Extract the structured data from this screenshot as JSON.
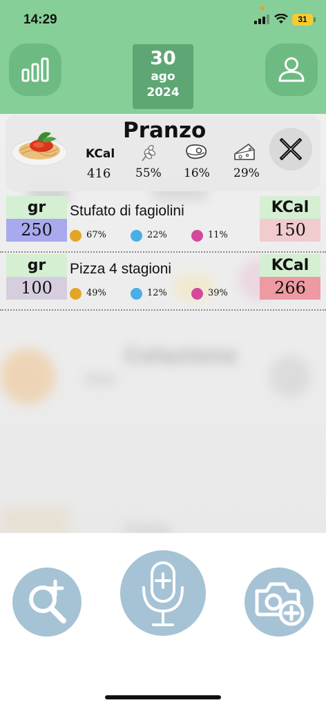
{
  "status_bar": {
    "time": "14:29",
    "battery": "31"
  },
  "header": {
    "date": {
      "day": "30",
      "month": "ago",
      "year": "2024"
    },
    "stats_icon": "bar-chart-icon",
    "profile_icon": "person-icon",
    "color": "#86cf98"
  },
  "meal": {
    "title": "Pranzo",
    "kcal_label": "KCal",
    "kcal_value": "416",
    "carbs_pct": "55%",
    "protein_pct": "16%",
    "fat_pct": "29%",
    "image_icon": "spaghetti-icon"
  },
  "foods": [
    {
      "unit_label": "gr",
      "quantity": "250",
      "name": "Stufato di fagiolini",
      "carbs": "67%",
      "protein": "22%",
      "fat": "11%",
      "kcal_label": "KCal",
      "kcal": "150",
      "qty_color": "#a9a9ef",
      "kcal_color": "#f2cbcf"
    },
    {
      "unit_label": "gr",
      "quantity": "100",
      "name": "Pizza 4 stagioni",
      "carbs": "49%",
      "protein": "12%",
      "fat": "39%",
      "kcal_label": "KCal",
      "kcal": "266",
      "qty_color": "#d6cedf",
      "kcal_color": "#ee9aa2"
    }
  ],
  "macro_colors": {
    "carbs": "#e3a526",
    "protein": "#4aaee6",
    "fat": "#d4489c"
  },
  "background_blurred": {
    "meal_title": "Colazione",
    "kcal_label": "KCal",
    "next_meal": "Cena"
  },
  "actions": {
    "search_add": "search-add-icon",
    "voice_add": "microphone-add-icon",
    "camera_add": "camera-add-icon",
    "button_color": "#a6c3d5"
  }
}
